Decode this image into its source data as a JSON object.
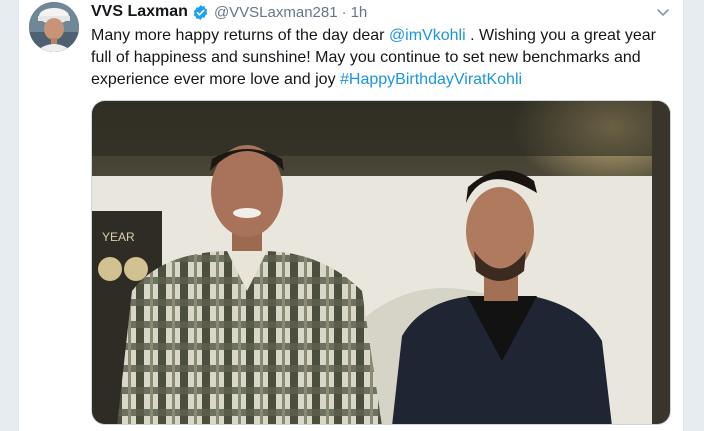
{
  "tweet": {
    "author_name": "VVS Laxman",
    "handle": "@VVSLaxman281",
    "separator": "·",
    "time": "1h",
    "text_before": "Many more happy returns of the day dear ",
    "mention": "@imVkohli",
    "text_middle": " . Wishing you a great year full of happiness and sunshine! May you continue to set new benchmarks and experience ever more love and joy ",
    "hashtag": "#HappyBirthdayViratKohli",
    "backdrop_text": "YEAR"
  },
  "icons": {
    "verified": "verified-badge-icon",
    "more": "chevron-down-icon"
  },
  "colors": {
    "link": "#1b95e0",
    "verified": "#1da1f2",
    "text": "#14171a",
    "muted": "#657786"
  }
}
